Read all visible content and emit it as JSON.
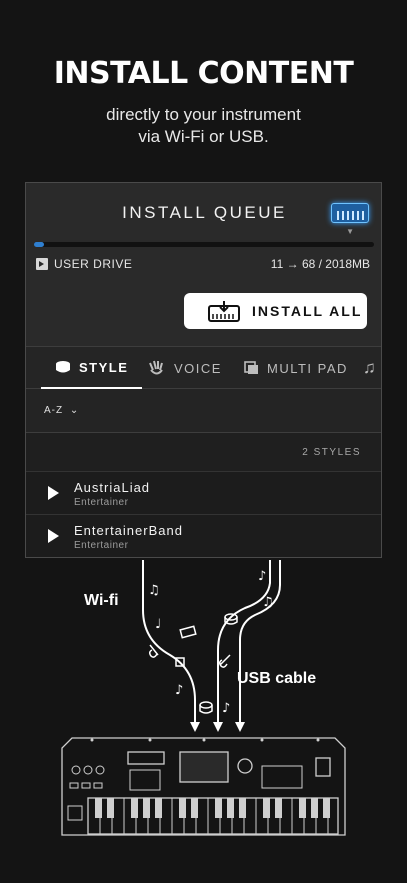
{
  "hero": {
    "title": "INSTALL CONTENT",
    "subtitle_line1": "directly to your instrument",
    "subtitle_line2": "via Wi-Fi or USB."
  },
  "queue": {
    "title": "INSTALL QUEUE",
    "progress_fraction": 0.03,
    "drive_label": "USER DRIVE",
    "count_start": "11",
    "count_arrow": "→",
    "count_total": "68 / 2018MB",
    "install_all_label": "INSTALL ALL"
  },
  "tabs": [
    {
      "label": "STYLE",
      "icon": "style-drum-icon",
      "active": true
    },
    {
      "label": "VOICE",
      "icon": "voice-hand-icon",
      "active": false
    },
    {
      "label": "MULTI PAD",
      "icon": "multi-pad-icon",
      "active": false
    },
    {
      "label": "",
      "icon": "music-note-icon",
      "active": false
    }
  ],
  "list": {
    "sort_label": "A-Z",
    "count_label": "2 STYLES",
    "items": [
      {
        "name": "AustriaLiad",
        "category": "Entertainer"
      },
      {
        "name": "EntertainerBand",
        "category": "Entertainer"
      }
    ]
  },
  "illustration": {
    "wifi_label": "Wi-fi",
    "usb_label": "USB cable"
  },
  "colors": {
    "background": "#141414",
    "panel": "#2a2a2a",
    "accent_blue": "#2f7fd0"
  }
}
